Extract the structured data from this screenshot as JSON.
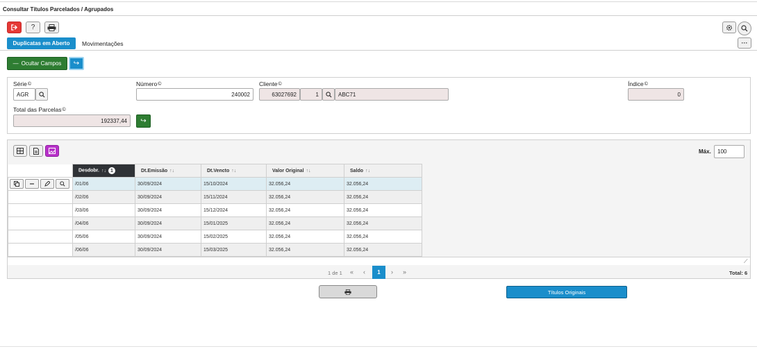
{
  "page": {
    "title": "Consultar Títulos Parcelados / Agrupados"
  },
  "toolbar": {
    "exit_icon": "exit-icon",
    "help_label": "?",
    "print_icon": "print-icon",
    "settings_icon": "gear-icon",
    "search_icon": "search-icon",
    "more_label": "···"
  },
  "tabs": [
    {
      "label": "Duplicatas em Aberto"
    },
    {
      "label": "Movimentações"
    }
  ],
  "actions": {
    "hide_fields": "Ocultar Campos",
    "hide_icon": "—",
    "arrow_icon": "↪"
  },
  "form": {
    "serie": {
      "label": "Série",
      "value": "AGR"
    },
    "numero": {
      "label": "Número",
      "value": "240002"
    },
    "cliente": {
      "label": "Cliente",
      "code": "63027692",
      "seq": "1",
      "name": "ABC71"
    },
    "indice": {
      "label": "Índice",
      "value": "0"
    },
    "total": {
      "label": "Total das Parcelas",
      "value": "192337,44"
    },
    "info_icon": "©"
  },
  "grid": {
    "max_label": "Máx.",
    "max_value": "100",
    "columns": [
      "Desdobr.",
      "Dt.Emissão",
      "Dt.Vencto",
      "Valor Original",
      "Saldo"
    ],
    "sort_badge": "1",
    "sort_icon": "↑↓",
    "rows": [
      [
        "/01/06",
        "30/09/2024",
        "15/10/2024",
        "32.056,24",
        "32.056,24"
      ],
      [
        "/02/06",
        "30/09/2024",
        "15/11/2024",
        "32.056,24",
        "32.056,24"
      ],
      [
        "/03/06",
        "30/09/2024",
        "15/12/2024",
        "32.056,24",
        "32.056,24"
      ],
      [
        "/04/06",
        "30/09/2024",
        "15/01/2025",
        "32.056,24",
        "32.056,24"
      ],
      [
        "/05/06",
        "30/09/2024",
        "15/02/2025",
        "32.056,24",
        "32.056,24"
      ],
      [
        "/06/06",
        "30/09/2024",
        "15/03/2025",
        "32.056,24",
        "32.056,24"
      ]
    ],
    "pager": {
      "summary": "1 de 1",
      "first": "«",
      "prev": "‹",
      "page": "1",
      "next": "›",
      "last": "»"
    },
    "total": "Total: 6"
  },
  "bottom": {
    "print_icon": "print-icon",
    "originals_label": "Títulos Originais"
  },
  "colors": {
    "accent": "#1a8ecb",
    "green": "#2e7d32",
    "red": "#e53935",
    "magenta": "#b832c9"
  }
}
